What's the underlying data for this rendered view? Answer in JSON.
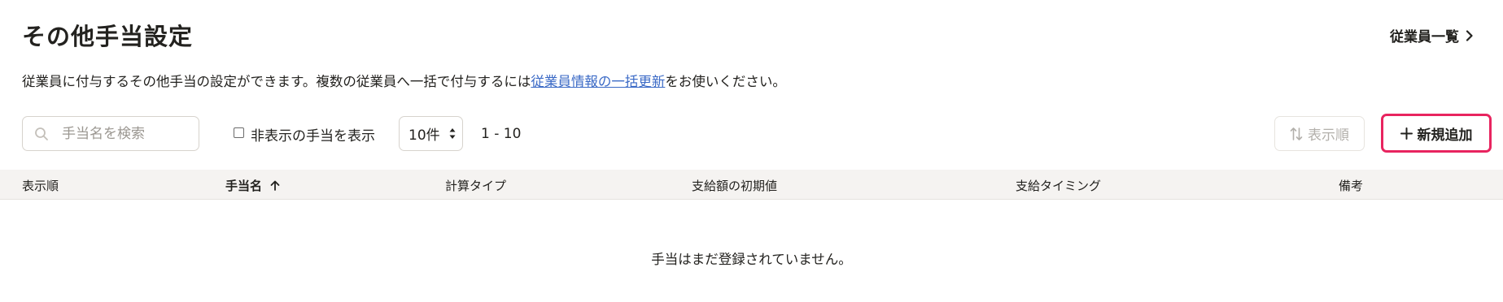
{
  "header": {
    "title": "その他手当設定",
    "employee_list_link": "従業員一覧"
  },
  "description": {
    "before": "従業員に付与するその他手当の設定ができます。複数の従業員へ一括で付与するには",
    "link": "従業員情報の一括更新",
    "after": "をお使いください。"
  },
  "toolbar": {
    "search_placeholder": "手当名を検索",
    "show_hidden_label": "非表示の手当を表示",
    "show_hidden_checked": false,
    "per_page": "10件",
    "range": "1 - 10",
    "sort_order_label": "表示順",
    "add_label": "新規追加",
    "accent_color": "#e8245f",
    "link_color": "#3b6ac6"
  },
  "table": {
    "columns": [
      {
        "label": "表示順"
      },
      {
        "label": "手当名"
      },
      {
        "label": "計算タイプ"
      },
      {
        "label": "支給額の初期値"
      },
      {
        "label": "支給タイミング"
      },
      {
        "label": "備考"
      }
    ],
    "sorted_column": "手当名",
    "sort_direction": "ascending",
    "empty_message": "手当はまだ登録されていません。"
  },
  "icons": {
    "search": "search-icon",
    "chevron": "chevron-right-icon",
    "sort": "sort-arrows-icon",
    "plus": "plus-icon",
    "sort_asc": "arrow-up-icon",
    "select": "select-arrows-icon"
  }
}
